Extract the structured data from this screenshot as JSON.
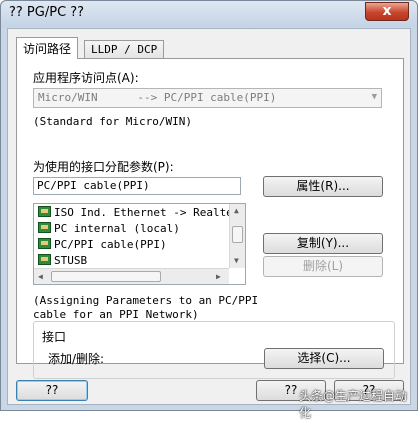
{
  "window": {
    "title": "?? PG/PC ??",
    "close_glyph": "x"
  },
  "tabs": [
    {
      "label": "访问路径"
    },
    {
      "label": "LLDP / DCP"
    }
  ],
  "access_point": {
    "label": "应用程序访问点(A):",
    "value": "Micro/WIN      --> PC/PPI cable(PPI)",
    "note": "(Standard for Micro/WIN)"
  },
  "params": {
    "label": "为使用的接口分配参数(P):",
    "value": "PC/PPI cable(PPI)",
    "properties_button": "属性(R)...",
    "copy_button": "复制(Y)...",
    "delete_button": "删除(L)"
  },
  "interface_list": {
    "items": [
      {
        "label": "ISO Ind. Ethernet -> Realtek"
      },
      {
        "label": "PC internal (local)"
      },
      {
        "label": "PC/PPI cable(PPI)"
      },
      {
        "label": "STUSB"
      }
    ]
  },
  "description": {
    "line1": "(Assigning Parameters to an PC/PPI",
    "line2": "cable for an PPI Network)"
  },
  "interfaces_group": {
    "title": "接口",
    "add_remove_label": "添加/删除:",
    "select_button": "选择(C)..."
  },
  "footer": {
    "ok_button": "??",
    "cancel_button": "??",
    "help_button": "??"
  },
  "watermark": "头条@生产过程自动化"
}
